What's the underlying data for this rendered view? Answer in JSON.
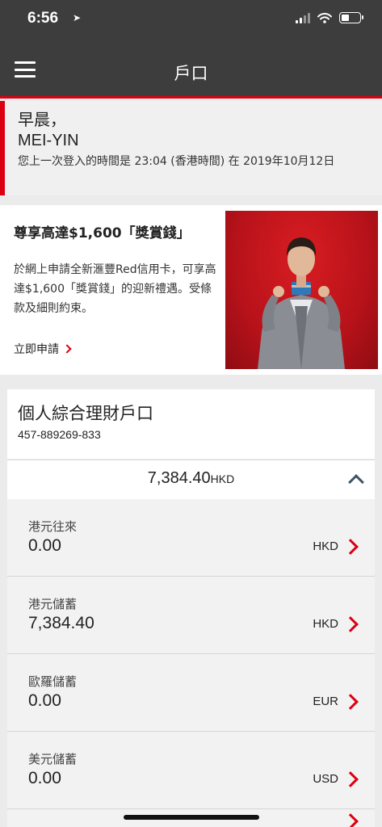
{
  "status_bar": {
    "time": "6:56"
  },
  "header": {
    "title": "戶口"
  },
  "greeting": {
    "salutation": "早晨，",
    "name": "MEI-YIN",
    "last_login": "您上一次登入的時間是 23:04 (香港時間) 在 2019年10月12日"
  },
  "promo": {
    "title": "尊享高達$1,600「獎賞錢」",
    "body": "於網上申請全新滙豐Red信用卡，可享高達$1,600「獎賞錢」的迎新禮遇。受條款及細則約束。",
    "link": "立即申請"
  },
  "account": {
    "name": "個人綜合理財戶口",
    "number": "457-889269-833",
    "balance": "7,384.40",
    "balance_currency": "HKD",
    "sub_accounts": [
      {
        "label": "港元往來",
        "amount": "0.00",
        "currency": "HKD"
      },
      {
        "label": "港元儲蓄",
        "amount": "7,384.40",
        "currency": "HKD"
      },
      {
        "label": "歐羅儲蓄",
        "amount": "0.00",
        "currency": "EUR"
      },
      {
        "label": "美元儲蓄",
        "amount": "0.00",
        "currency": "USD"
      }
    ]
  },
  "colors": {
    "brand_red": "#db0011",
    "header_dark": "#3d3d3d"
  }
}
